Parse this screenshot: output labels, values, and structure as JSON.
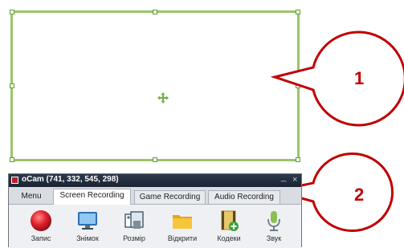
{
  "window": {
    "title": "oCam (741, 332, 545, 298)",
    "minimize": "_",
    "close": "×"
  },
  "tabs": [
    {
      "label": "Menu"
    },
    {
      "label": "Screen Recording"
    },
    {
      "label": "Game Recording"
    },
    {
      "label": "Audio Recording"
    }
  ],
  "toolbar": {
    "items": [
      {
        "label": "Запис",
        "icon": "record-icon"
      },
      {
        "label": "Знімок",
        "icon": "screenshot-icon"
      },
      {
        "label": "Розмір",
        "icon": "resize-icon"
      },
      {
        "label": "Відкрити",
        "icon": "folder-icon"
      },
      {
        "label": "Кодеки",
        "icon": "codecs-icon"
      },
      {
        "label": "Звук",
        "icon": "microphone-icon"
      }
    ]
  },
  "callouts": [
    {
      "number": "1"
    },
    {
      "number": "2"
    }
  ],
  "colors": {
    "frame": "#9bc468",
    "callout": "#c00000",
    "record": "#d9202c"
  }
}
